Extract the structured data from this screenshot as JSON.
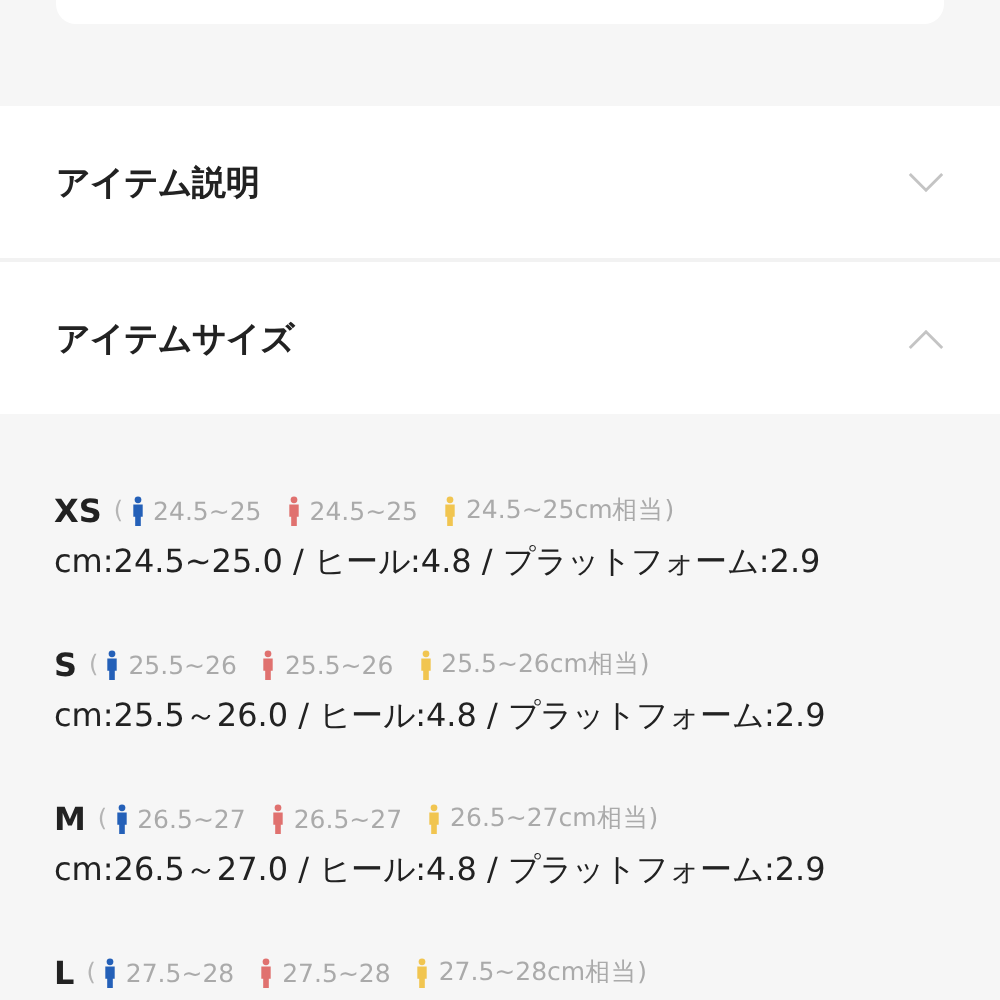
{
  "accordion": [
    {
      "title": "アイテム説明",
      "expanded": false
    },
    {
      "title": "アイテムサイズ",
      "expanded": true
    }
  ],
  "sizes": [
    {
      "size": "XS",
      "open": "(",
      "ranges": [
        {
          "kind": "men",
          "text": "24.5~25"
        },
        {
          "kind": "women",
          "text": "24.5~25"
        },
        {
          "kind": "unisex",
          "text": "24.5~25cm相当)"
        }
      ],
      "detail": "cm:24.5~25.0 / ヒール:4.8 / プラットフォーム:2.9"
    },
    {
      "size": "S",
      "open": "(",
      "ranges": [
        {
          "kind": "men",
          "text": "25.5~26"
        },
        {
          "kind": "women",
          "text": "25.5~26"
        },
        {
          "kind": "unisex",
          "text": "25.5~26cm相当)"
        }
      ],
      "detail": "cm:25.5～26.0 / ヒール:4.8 / プラットフォーム:2.9"
    },
    {
      "size": "M",
      "open": "(",
      "ranges": [
        {
          "kind": "men",
          "text": "26.5~27"
        },
        {
          "kind": "women",
          "text": "26.5~27"
        },
        {
          "kind": "unisex",
          "text": "26.5~27cm相当)"
        }
      ],
      "detail": "cm:26.5～27.0 / ヒール:4.8 / プラットフォーム:2.9"
    },
    {
      "size": "L",
      "open": "(",
      "ranges": [
        {
          "kind": "men",
          "text": "27.5~28"
        },
        {
          "kind": "women",
          "text": "27.5~28"
        },
        {
          "kind": "unisex",
          "text": "27.5~28cm相当)"
        }
      ]
    }
  ]
}
